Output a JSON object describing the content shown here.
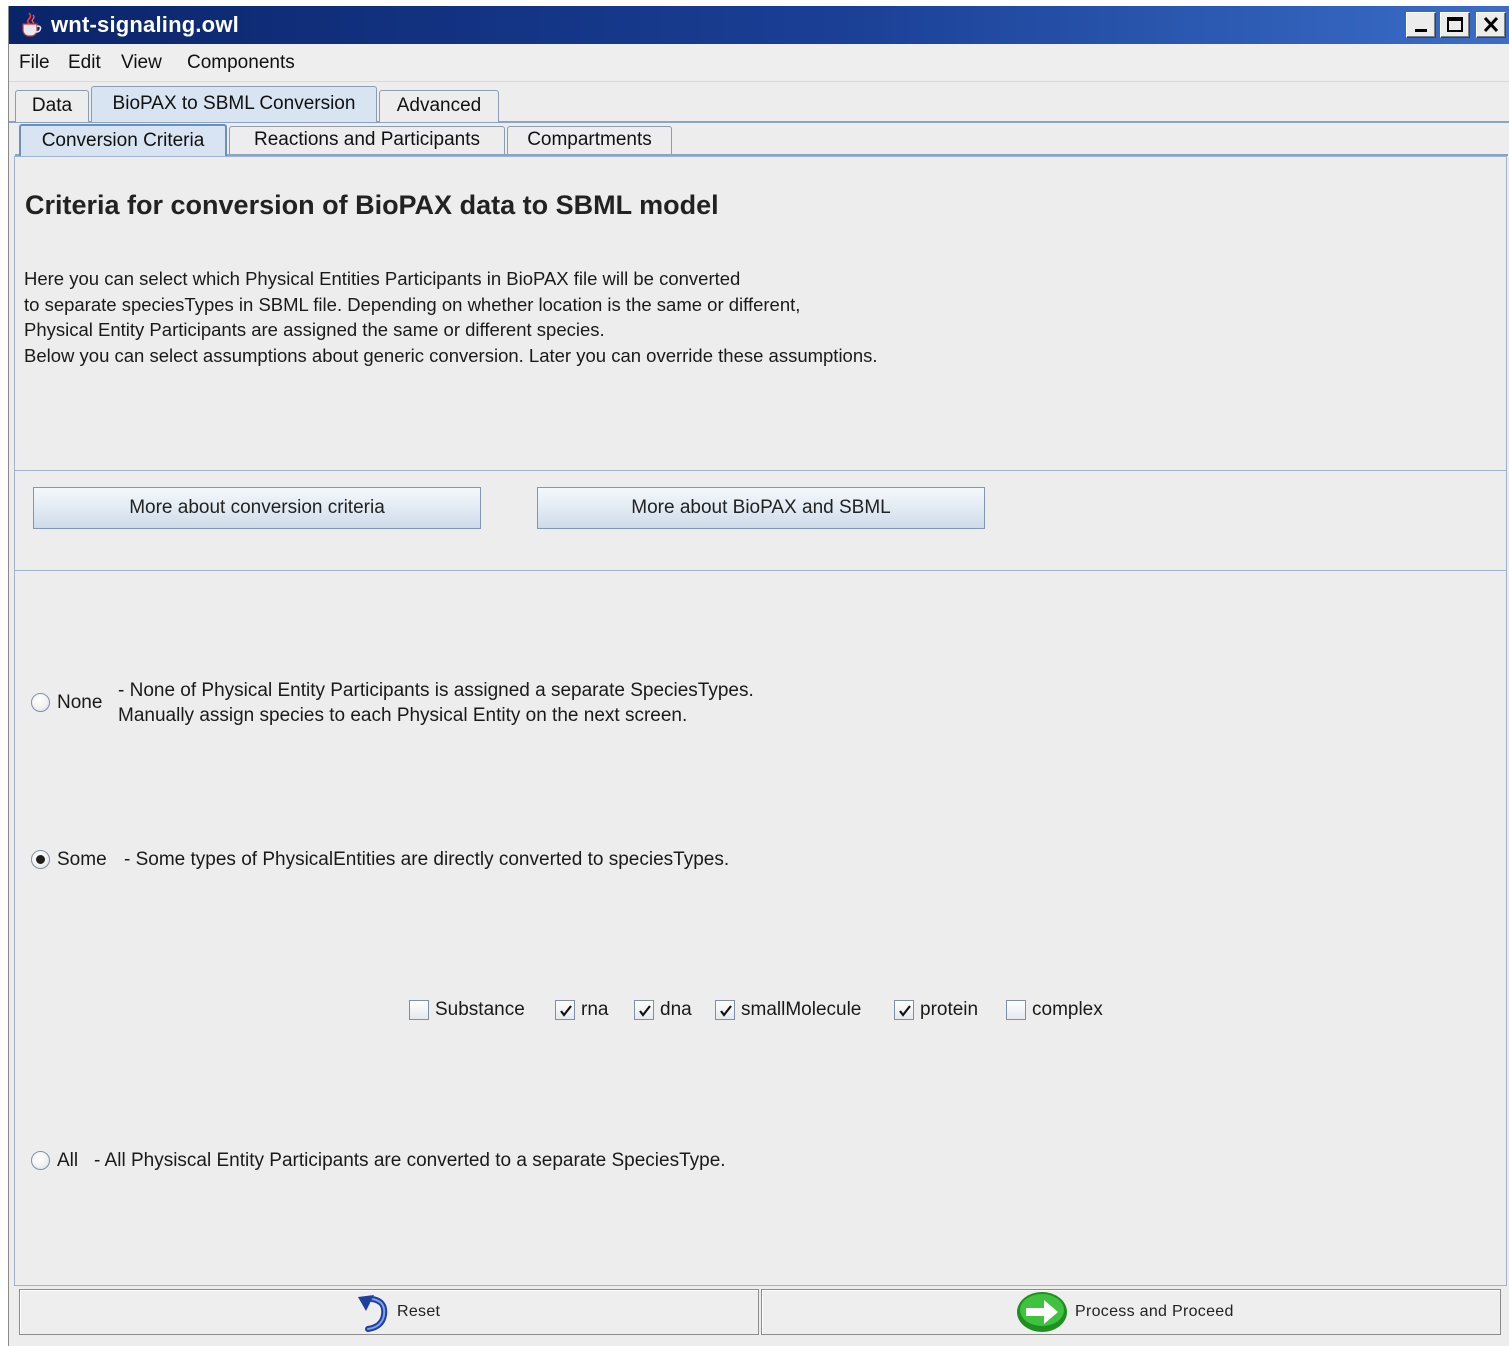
{
  "window": {
    "title": "wnt-signaling.owl",
    "icons": {
      "app": "java-cup-icon",
      "minimize": "minimize-icon",
      "maximize": "maximize-icon",
      "close": "close-icon"
    }
  },
  "menu": [
    "File",
    "Edit",
    "View",
    "Components"
  ],
  "tabs": {
    "main": [
      "Data",
      "BioPAX to SBML Conversion",
      "Advanced"
    ],
    "main_selected": "BioPAX to SBML Conversion",
    "sub": [
      "Conversion Criteria",
      "Reactions and Participants",
      "Compartments"
    ],
    "sub_selected": "Conversion Criteria"
  },
  "main": {
    "heading": "Criteria for conversion of BioPAX data to SBML model",
    "description": [
      "Here you can select which Physical Entities Participants in BioPAX file will be converted",
      "to separate speciesTypes in SBML file. Depending on whether location is the same or different,",
      "Physical Entity Participants are assigned the same or different species.",
      "Below you can select assumptions about generic conversion. Later you can override these assumptions."
    ],
    "buttons": {
      "criteria": "More about conversion criteria",
      "biopax": "More about BioPAX and SBML"
    },
    "options": {
      "none": {
        "label": "None",
        "line1": "- None of Physical Entity Participants is assigned a separate SpeciesTypes.",
        "line2": "Manually assign species to each Physical Entity on the next screen.",
        "selected": false
      },
      "some": {
        "label": "Some",
        "desc": "- Some types of PhysicalEntities are directly converted to speciesTypes.",
        "selected": true
      },
      "all": {
        "label": "All",
        "desc": "- All Physiscal Entity Participants are converted to a separate SpeciesType.",
        "selected": false
      }
    },
    "types": [
      {
        "label": "Substance",
        "checked": false
      },
      {
        "label": "rna",
        "checked": true
      },
      {
        "label": "dna",
        "checked": true
      },
      {
        "label": "smallMolecule",
        "checked": true
      },
      {
        "label": "protein",
        "checked": true
      },
      {
        "label": "complex",
        "checked": false
      }
    ]
  },
  "footer": {
    "reset": {
      "label": "Reset",
      "icon": "undo-arrow-icon"
    },
    "proceed": {
      "label": "Process and Proceed",
      "icon": "green-arrow-right-icon"
    }
  },
  "colors": {
    "titlebar": "#0a246a",
    "selected_tab": "#d8e4f1",
    "proceed_icon": "#2db52d"
  }
}
